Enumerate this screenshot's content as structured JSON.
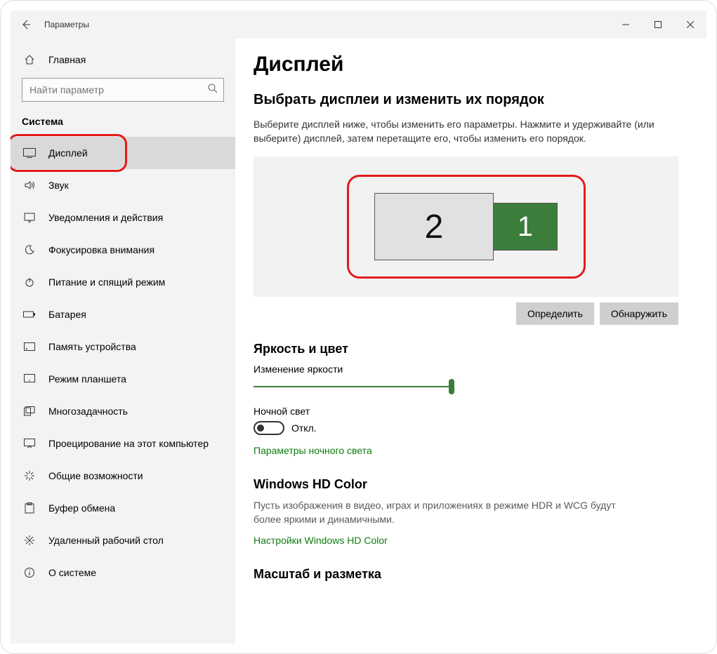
{
  "window": {
    "title": "Параметры"
  },
  "sidebar": {
    "home_label": "Главная",
    "search_placeholder": "Найти параметр",
    "category_label": "Система",
    "items": [
      {
        "label": "Дисплей"
      },
      {
        "label": "Звук"
      },
      {
        "label": "Уведомления и действия"
      },
      {
        "label": "Фокусировка внимания"
      },
      {
        "label": "Питание и спящий режим"
      },
      {
        "label": "Батарея"
      },
      {
        "label": "Память устройства"
      },
      {
        "label": "Режим планшета"
      },
      {
        "label": "Многозадачность"
      },
      {
        "label": "Проецирование на этот компьютер"
      },
      {
        "label": "Общие возможности"
      },
      {
        "label": "Буфер обмена"
      },
      {
        "label": "Удаленный рабочий стол"
      },
      {
        "label": "О системе"
      }
    ]
  },
  "main": {
    "page_title": "Дисплей",
    "arrange_heading": "Выбрать дисплеи и изменить их порядок",
    "arrange_desc": "Выберите дисплей ниже, чтобы изменить его параметры. Нажмите и удерживайте (или выберите) дисплей, затем перетащите его, чтобы изменить его порядок.",
    "display_1": "1",
    "display_2": "2",
    "identify_btn": "Определить",
    "detect_btn": "Обнаружить",
    "brightness_heading": "Яркость и цвет",
    "brightness_label": "Изменение яркости",
    "night_light_label": "Ночной свет",
    "toggle_off_label": "Откл.",
    "night_light_link": "Параметры ночного света",
    "hd_heading": "Windows HD Color",
    "hd_desc": "Пусть изображения в видео, играх и приложениях в режиме HDR и WCG будут более яркими и динамичными.",
    "hd_link": "Настройки Windows HD Color",
    "scale_heading": "Масштаб и разметка"
  }
}
